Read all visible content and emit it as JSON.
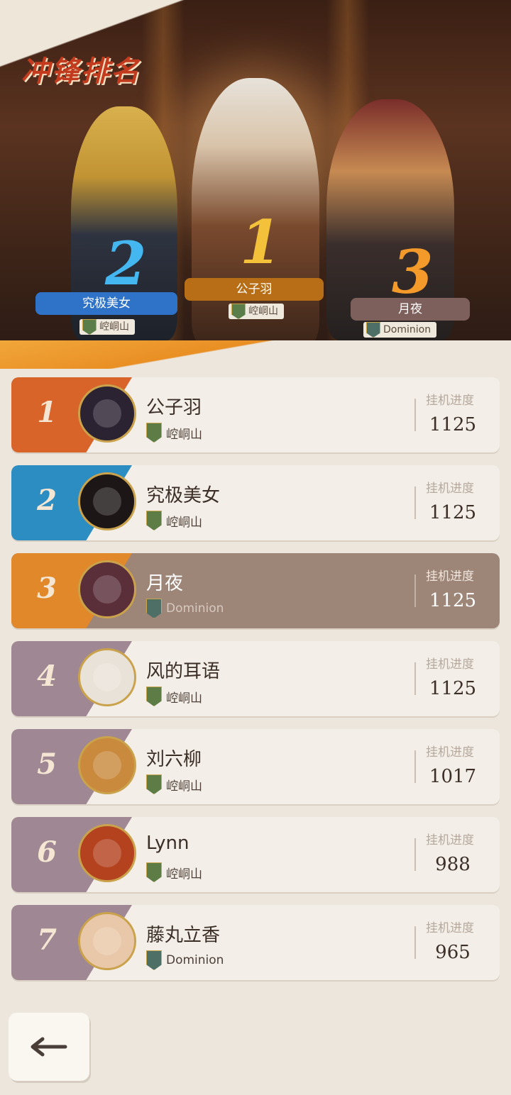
{
  "header": {
    "title": "冲锋排名"
  },
  "podium": [
    {
      "rank": "2",
      "name": "究极美女",
      "server": "崆峒山",
      "color": "#2f73c9",
      "num_color": "#45b7f0"
    },
    {
      "rank": "1",
      "name": "公子羽",
      "server": "崆峒山",
      "color": "#b76e16",
      "num_color": "#f3c23a"
    },
    {
      "rank": "3",
      "name": "月夜",
      "server": "Dominion",
      "color": "#7d5f5b",
      "num_color": "#f39a2a"
    }
  ],
  "progress_label": "挂机进度",
  "rows": [
    {
      "rank": "1",
      "name": "公子羽",
      "server": "崆峒山",
      "progress": "1125",
      "band": "#d9642a",
      "highlight": false,
      "avatar": "#2b2331"
    },
    {
      "rank": "2",
      "name": "究极美女",
      "server": "崆峒山",
      "progress": "1125",
      "band": "#2c8dc2",
      "highlight": false,
      "avatar": "#1c1616"
    },
    {
      "rank": "3",
      "name": "月夜",
      "server": "Dominion",
      "progress": "1125",
      "band": "#e1892a",
      "highlight": true,
      "avatar": "#5a2f3a"
    },
    {
      "rank": "4",
      "name": "风的耳语",
      "server": "崆峒山",
      "progress": "1125",
      "band": "#9f8893",
      "highlight": false,
      "avatar": "#e9e2d8"
    },
    {
      "rank": "5",
      "name": "刘六柳",
      "server": "崆峒山",
      "progress": "1017",
      "band": "#9f8893",
      "highlight": false,
      "avatar": "#c98a3d"
    },
    {
      "rank": "6",
      "name": "Lynn",
      "server": "崆峒山",
      "progress": "988",
      "band": "#9f8893",
      "highlight": false,
      "avatar": "#b4421f"
    },
    {
      "rank": "7",
      "name": "藤丸立香",
      "server": "Dominion",
      "progress": "965",
      "band": "#9f8893",
      "highlight": false,
      "avatar": "#e9c8a9"
    }
  ]
}
